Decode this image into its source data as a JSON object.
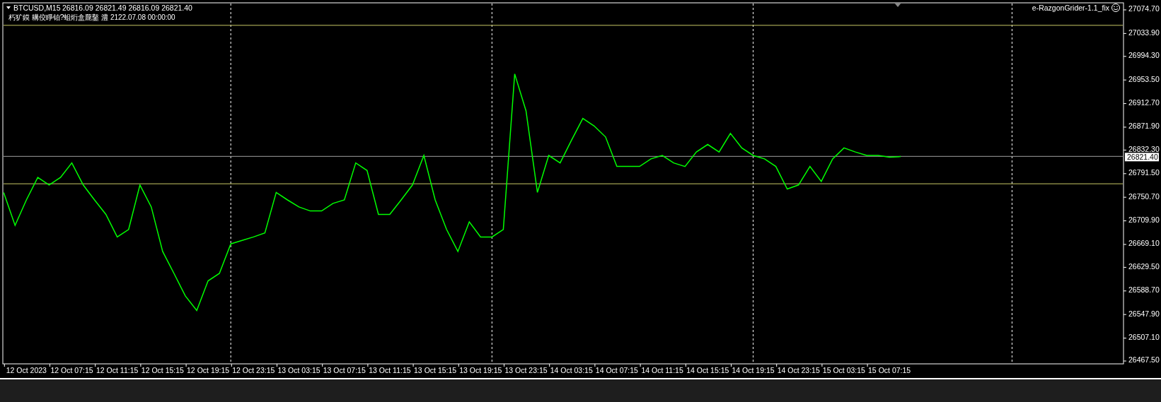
{
  "chart_header": {
    "symbol": "BTCUSD,M15",
    "ohlc": "26816.09 26821.49 26816.09 26821.40",
    "comment": "朽犷鏌 耩佼睜铂?蛆烆盒龎鑿 澧 2122.07.08 00:00:00"
  },
  "expert": {
    "name": "e-RazgonGrider-1.1_fix"
  },
  "chart": {
    "chart_data": {
      "type": "line",
      "categories": [
        null,
        null,
        "12 Oct 2023",
        null,
        null,
        null,
        "12 Oct 07:15",
        null,
        null,
        null,
        "12 Oct 11:15",
        null,
        null,
        null,
        "12 Oct 15:15",
        null,
        null,
        null,
        "12 Oct 19:15",
        null,
        null,
        null,
        "12 Oct 23:15",
        null,
        null,
        null,
        "13 Oct 03:15",
        null,
        null,
        null,
        "13 Oct 07:15",
        null,
        null,
        null,
        "13 Oct 11:15",
        null,
        null,
        null,
        "13 Oct 15:15",
        null,
        null,
        null,
        "13 Oct 19:15",
        null,
        null,
        null,
        "13 Oct 23:15",
        null,
        null,
        null,
        "14 Oct 03:15",
        null,
        null,
        null,
        "14 Oct 07:15",
        null,
        null,
        null,
        "14 Oct 11:15",
        null,
        null,
        null,
        "14 Oct 15:15",
        null,
        null,
        null,
        "14 Oct 19:15",
        null,
        null,
        null,
        "14 Oct 23:15",
        null,
        null,
        null,
        "15 Oct 03:15",
        null,
        null,
        null,
        "15 Oct 07:15",
        null
      ],
      "grid": true,
      "series": [
        {
          "color": "#00ff00",
          "values": [
            26759,
            26702,
            26746,
            26785,
            26772,
            26785,
            26810,
            26772,
            26746,
            26721,
            26682,
            26695,
            26772,
            26734,
            26657,
            26619,
            26580,
            26555,
            26606,
            26619,
            26670,
            26676,
            26682,
            26689,
            26759,
            26746,
            26734,
            26727,
            26727,
            26740,
            26746,
            26810,
            26797,
            26721,
            26721,
            26746,
            26772,
            26823,
            26746,
            26695,
            26657,
            26708,
            26682,
            26682,
            26695,
            26964,
            26900,
            26759,
            26823,
            26810,
            26849,
            26887,
            26874,
            26855,
            26804,
            26804,
            26804,
            26817,
            26823,
            26810,
            26804,
            26829,
            26842,
            26829,
            26861,
            26836,
            26823,
            26817,
            26804,
            26765,
            26772,
            26804,
            26778,
            26817,
            26836,
            26829,
            26823,
            26823,
            26820,
            26821
          ]
        }
      ],
      "ylim": [
        26462.6,
        27086.9
      ],
      "yticks": [
        {
          "value": 27074.7,
          "label": "27074.70"
        },
        {
          "value": 27033.9,
          "label": "27033.90"
        },
        {
          "value": 26994.3,
          "label": "26994.30"
        },
        {
          "value": 26953.5,
          "label": "26953.50"
        },
        {
          "value": 26912.7,
          "label": "26912.70"
        },
        {
          "value": 26871.9,
          "label": "26871.90"
        },
        {
          "value": 26832.3,
          "label": "26832.30"
        },
        {
          "value": 26791.5,
          "label": "26791.50"
        },
        {
          "value": 26750.7,
          "label": "26750.70"
        },
        {
          "value": 26709.9,
          "label": "26709.90"
        },
        {
          "value": 26669.1,
          "label": "26669.10"
        },
        {
          "value": 26629.5,
          "label": "26629.50"
        },
        {
          "value": 26588.7,
          "label": "26588.70"
        },
        {
          "value": 26547.9,
          "label": "26547.90"
        },
        {
          "value": 26507.1,
          "label": "26507.10"
        },
        {
          "value": 26467.5,
          "label": "26467.50"
        }
      ],
      "ref_lines": [
        {
          "axis": "y",
          "value": 27048,
          "color": "#c8c864"
        },
        {
          "axis": "y",
          "value": 26774,
          "color": "#c8c864"
        },
        {
          "axis": "y",
          "value": 26821.4,
          "label": "26821.40",
          "color": "#a0a0a0"
        }
      ]
    }
  }
}
